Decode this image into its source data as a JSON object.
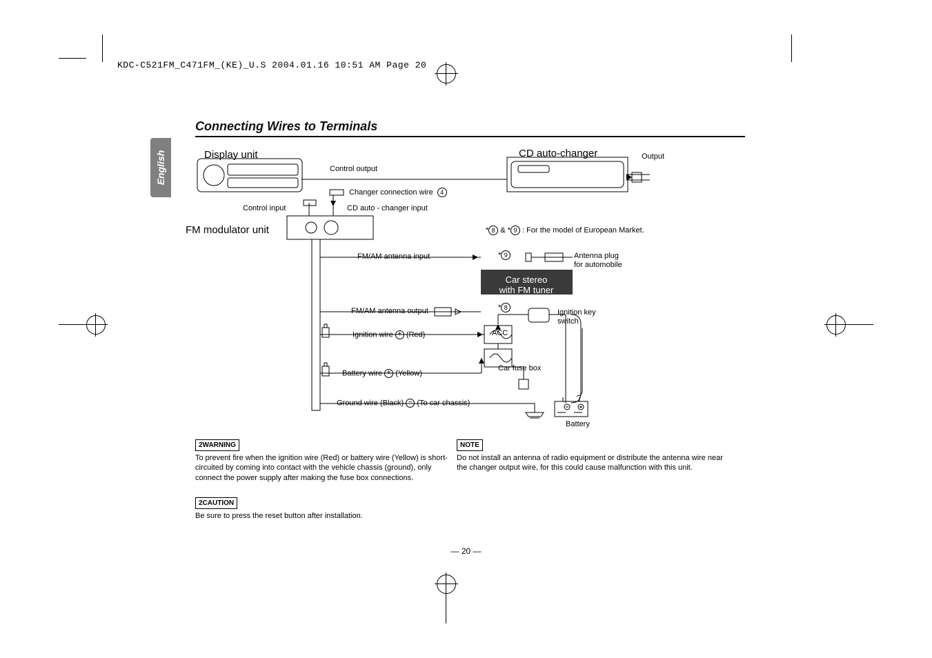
{
  "print_header": "KDC-C521FM_C471FM_(KE)_U.S  2004.01.16  10:51 AM  Page 20",
  "lang_tab": "English",
  "title": "Connecting Wires to Terminals",
  "labels": {
    "display_unit": "Display unit",
    "cd_changer": "CD auto-changer",
    "output": "Output",
    "control_output": "Control output",
    "changer_conn": "Changer connection wire",
    "changer_conn_ref": "4",
    "control_input": "Control input",
    "cd_input": "CD auto - changer input",
    "fm_modulator": "FM modulator unit",
    "euro_note_prefix": "*",
    "euro_note_ref1": "8",
    "euro_note_mid": " & *",
    "euro_note_ref2": "9",
    "euro_note_suffix": " : For the model of European Market.",
    "fm_antenna_in": "FM/AM antenna input",
    "antenna_plug_l1": "Antenna plug",
    "antenna_plug_l2": "for automobile",
    "car_stereo_l1": "Car stereo",
    "car_stereo_l2": "with FM tuner",
    "fm_antenna_out": "FM/AM antenna output",
    "ignition_key_l1": "Ignition key",
    "ignition_key_l2": "switch",
    "ignition_wire": "Ignition wire",
    "ignition_wire_suffix": " (Red)",
    "acc": "ACC",
    "battery_wire": "Battery wire",
    "battery_wire_suffix": " (Yellow)",
    "car_fuse": "Car fuse box",
    "ground_wire": "Ground wire (Black)",
    "ground_wire_suffix": " (To car chassis)",
    "battery": "Battery",
    "ref8": "8",
    "ref9": "9"
  },
  "warning": {
    "tag": "2WARNING",
    "text": "To prevent fire when the ignition wire (Red) or battery wire (Yellow) is short-circuited by coming into contact with the vehicle chassis (ground), only connect the power supply after making the fuse box connections."
  },
  "caution": {
    "tag": "2CAUTION",
    "text": "Be sure to press the reset button after installation."
  },
  "note": {
    "tag": "NOTE",
    "text": "Do not install an antenna of radio equipment or distribute the antenna wire near the changer output wire, for this could cause malfunction with this unit."
  },
  "page_num": "— 20 —"
}
